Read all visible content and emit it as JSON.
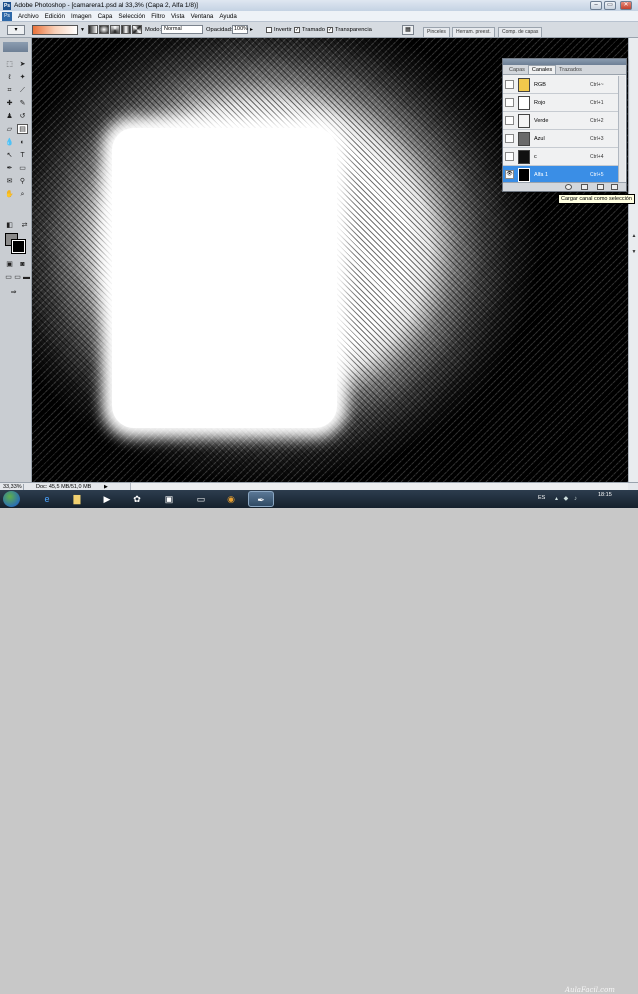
{
  "window": {
    "title": "Adobe Photoshop - [camarera1.psd al 33,3% (Capa 2, Alfa 1/8)]",
    "app_badge": "Ps",
    "controls": {
      "minimize": "–",
      "restore": "▭",
      "close": "✕"
    }
  },
  "menubar": {
    "items": [
      "Archivo",
      "Edición",
      "Imagen",
      "Capa",
      "Selección",
      "Filtro",
      "Vista",
      "Ventana",
      "Ayuda"
    ]
  },
  "options_bar": {
    "mode_label": "Modo:",
    "mode_value": "Normal",
    "opacity_label": "Opacidad:",
    "opacity_value": "100%",
    "invertir_label": "Invertir",
    "invertir_checked": false,
    "tramado_label": "Tramado",
    "tramado_checked": true,
    "transparencia_label": "Transparencia",
    "transparencia_checked": true,
    "panel_tabs": [
      "Pinceles",
      "Herram. preest.",
      "Comp. de capas"
    ]
  },
  "channels_panel": {
    "tabs": [
      "Capas",
      "Canales",
      "Trazados"
    ],
    "active_tab": "Canales",
    "channels": [
      {
        "name": "RGB",
        "shortcut": "Ctrl+~",
        "thumb_color": "#f2c94c",
        "visible": false,
        "selected": false
      },
      {
        "name": "Rojo",
        "shortcut": "Ctrl+1",
        "thumb_color": "#ffffff",
        "visible": false,
        "selected": false
      },
      {
        "name": "Verde",
        "shortcut": "Ctrl+2",
        "thumb_color": "#f4f4f4",
        "visible": false,
        "selected": false
      },
      {
        "name": "Azul",
        "shortcut": "Ctrl+3",
        "thumb_color": "#6a6a6a",
        "visible": false,
        "selected": false
      },
      {
        "name": "c",
        "shortcut": "Ctrl+4",
        "thumb_color": "#111111",
        "visible": false,
        "selected": false
      },
      {
        "name": "Alfa 1",
        "shortcut": "Ctrl+5",
        "thumb_color": "#000000",
        "visible": true,
        "selected": true
      }
    ],
    "tooltip": "Cargar canal como selección"
  },
  "statusbar": {
    "zoom": "33,33%",
    "doc_info": "Doc: 45,5 MB/51,0 MB"
  },
  "taskbar": {
    "language": "ES",
    "time": "18:15",
    "watermark": "AulaFacil.com"
  },
  "colors": {
    "foreground": "#8a8a8a",
    "background": "#000000",
    "selected_row": "#3a8ee6"
  }
}
